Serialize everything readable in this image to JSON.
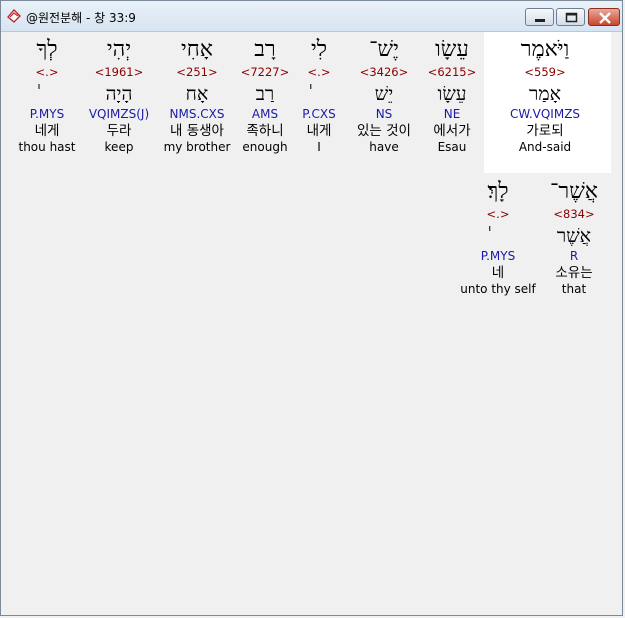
{
  "window": {
    "title": "@원전분해 - 창 33:9",
    "icon": "bible-app-icon",
    "buttons": [
      "minimize-icon",
      "maximize-icon",
      "close-icon"
    ]
  },
  "words": [
    {
      "hebrew": "וַיֹּאמֶר",
      "strong": "<559>",
      "root": "אָמַר",
      "morph": "CW.VQIMZS",
      "korean": "가로되",
      "english": "And-said"
    },
    {
      "hebrew": "עֵשָׂו",
      "strong": "<6215>",
      "root": "עֵשָׂו",
      "morph": "NE",
      "korean": "에서가",
      "english": "Esau"
    },
    {
      "hebrew": "יֶשׁ־",
      "strong": "<3426>",
      "root": "יֵשׁ",
      "morph": "NS",
      "korean": "있는 것이",
      "english": "have"
    },
    {
      "hebrew": "לִי",
      "strong": "<.>",
      "root": "",
      "morph": "P.CXS",
      "korean": "내게",
      "english": "I"
    },
    {
      "hebrew": "רָב",
      "strong": "<7227>",
      "root": "רַב",
      "morph": "AMS",
      "korean": "족하니",
      "english": "enough"
    },
    {
      "hebrew": "אָחִי",
      "strong": "<251>",
      "root": "אָח",
      "morph": "NMS.CXS",
      "korean": "내 동생아",
      "english": "my brother"
    },
    {
      "hebrew": "יְהִי",
      "strong": "<1961>",
      "root": "הָיָה",
      "morph": "VQIMZS(J)",
      "korean": "두라",
      "english": "keep"
    },
    {
      "hebrew": "לְךָ",
      "strong": "<.>",
      "root": "",
      "morph": "P.MYS",
      "korean": "네게",
      "english": "thou hast"
    },
    {
      "hebrew": "אֲשֶׁר־",
      "strong": "<834>",
      "root": "אֲשֶׁר",
      "morph": "R",
      "korean": "소유는",
      "english": "that"
    },
    {
      "hebrew": "לָךְ׃",
      "strong": "<.>",
      "root": "",
      "morph": "P.MYS",
      "korean": "네",
      "english": "unto thy self"
    }
  ]
}
